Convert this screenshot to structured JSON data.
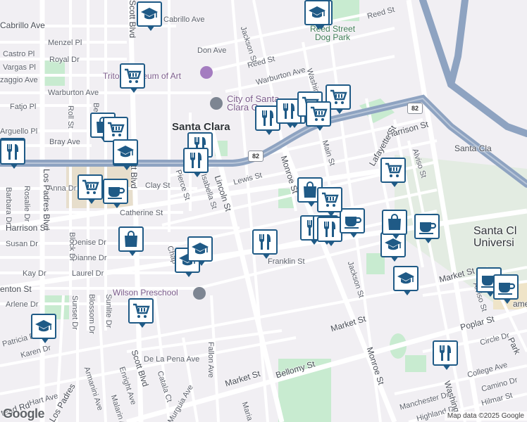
{
  "map": {
    "attribution": "Map data ©2025 Google",
    "logo": "Google",
    "colors": {
      "background": "#f1eff3",
      "road": "#ffffff",
      "highway": "#8ea3c1",
      "park": "#c8ebd0",
      "campus": "#e7decc",
      "marker_border": "#1f5a86",
      "marker_icon": "#1f5a86"
    }
  },
  "labels": {
    "cabrillo_ave_left": "Cabrillo Ave",
    "cabrillo_ave_top": "Cabrillo Ave",
    "menzel_pl": "Menzel Pl",
    "castro_pl": "Castro Pl",
    "royal_dr": "Royal Dr",
    "vargas_pl": "Vargas Pl",
    "zaggio_ave": "zaggio Ave",
    "warburton_ave_left": "Warburton Ave",
    "warburton_ave_right": "Warburton Ave",
    "fatjo_pl": "Fatjo Pl",
    "arguello_pl": "Arguello Pl",
    "bray_ave": "Bray Ave",
    "don_ave": "Don Ave",
    "reed_st_top": "Reed St",
    "reed_st_mid": "Reed St",
    "jackson_st_top": "Jackson St",
    "washington_top": "Washingt",
    "reed_street_dog_park": "Reed Street\nDog Park",
    "triton_museum": "Triton Museum of Art",
    "city_of_santa_clara": "City of Santa\nClara Gov...",
    "santa_clara": "Santa Clara",
    "santa_clara_right": "Santa Cla",
    "santa_clara_university": "Santa Cl\nUniversi",
    "harrison_st_right": "Harrison St",
    "harrison_st_left": "Harrison St",
    "lafayette_st": "Lafayette St",
    "main_st": "Main St",
    "monroe_st_mid": "Monroe St",
    "monroe_st_bottom": "Monroe St",
    "lincoln_st": "Lincoln St",
    "lewis_st": "Lewis St",
    "clay_st": "Clay St",
    "anna_dr": "Anna Dr",
    "pierce_st": "Pierce St",
    "isabella_st": "Isabella St",
    "catherine_st": "Catherine St",
    "susan_dr": "Susan Dr",
    "denise_dr": "Denise Dr",
    "dianne_dr": "Dianne Dr",
    "laurel_dr": "Laurel Dr",
    "kay_dr": "Kay Dr",
    "arlene_dr": "Arlene Dr",
    "benton_st": "enton St",
    "wilson_preschool": "Wilson Preschool",
    "franklin_st": "Franklin St",
    "jackson_st_lower": "Jackson St",
    "market_st_right": "Market St",
    "market_st_mid": "Market St",
    "market_st_left": "Market St",
    "alviso_st_upper": "Alviso St",
    "alviso_st_lower": "Alviso St",
    "poplar_st": "Poplar St",
    "circle_dr": "Circle Dr",
    "college_ave": "College Ave",
    "camino_dr": "Camino Dr",
    "hilmar_st": "Hilmar St",
    "manchester_dr": "Manchester Dr",
    "highland_dr": "Highland Dr",
    "washington_bottom": "Washing",
    "bellomy_st": "Bellomy St",
    "de_la_pena_ave": "De La Pena Ave",
    "fallon_ave": "Fallon Ave",
    "catala_ct": "Catala Ct",
    "murguia_ave": "Murguia Ave",
    "enright_ave": "Enright Ave",
    "malarin_ave": "Malarin A",
    "armanini_ave": "Armanini Ave",
    "hart_ave": "Hart Ave",
    "los_padres_blvd_top": "Los Padres Blvd",
    "los_padres_blvd_bottom": "Los Padres",
    "scott_blvd_top": "Scott Blvd",
    "scott_blvd_mid": "Scott Blvd",
    "scott_blvd_bottom": "Scott Blvd",
    "block_dr": "Block Dr",
    "rosalie_dr": "Rosalie Dr",
    "barbara_dr": "Barbara Dr",
    "roll_st": "Roll St",
    "bel_st": "Bel",
    "sunset_dr": "Sunset Dr",
    "blossom_dr": "Blossom Dr",
    "sunlite_dr": "Sunlite Dr",
    "karen_dr": "Karen Dr",
    "patricia_dr": "Patricia Dr",
    "mead_rd": "tead Rd",
    "chap": "Chap",
    "maria": "Maria",
    "park": "Park",
    "ame": "ame",
    "route_82": "82",
    "route_82_b": "82"
  },
  "markers": [
    {
      "name": "school-icon",
      "kind": "school"
    },
    {
      "name": "grocery-icon",
      "kind": "grocery"
    },
    {
      "name": "cafe-icon",
      "kind": "cafe"
    },
    {
      "name": "grocery-icon",
      "kind": "grocery"
    },
    {
      "name": "restaurant-icon",
      "kind": "restaurant"
    },
    {
      "name": "restaurant-icon",
      "kind": "restaurant"
    },
    {
      "name": "grocery-icon",
      "kind": "grocery"
    },
    {
      "name": "grocery-icon",
      "kind": "grocery"
    },
    {
      "name": "grocery-icon",
      "kind": "grocery"
    },
    {
      "name": "shopping-bag-icon",
      "kind": "shop"
    },
    {
      "name": "restaurant-icon",
      "kind": "restaurant"
    },
    {
      "name": "restaurant-icon",
      "kind": "restaurant"
    },
    {
      "name": "grocery-icon",
      "kind": "grocery"
    },
    {
      "name": "cafe-icon",
      "kind": "cafe"
    },
    {
      "name": "shopping-bag-icon",
      "kind": "shop"
    },
    {
      "name": "school-icon",
      "kind": "school"
    },
    {
      "name": "school-icon",
      "kind": "school"
    },
    {
      "name": "restaurant-icon",
      "kind": "restaurant"
    },
    {
      "name": "shopping-bag-icon",
      "kind": "shop"
    },
    {
      "name": "grocery-icon",
      "kind": "grocery"
    },
    {
      "name": "grocery-icon",
      "kind": "grocery"
    },
    {
      "name": "restaurant-icon",
      "kind": "restaurant"
    },
    {
      "name": "restaurant-icon",
      "kind": "restaurant"
    },
    {
      "name": "restaurant-icon",
      "kind": "restaurant"
    },
    {
      "name": "cafe-icon",
      "kind": "cafe"
    },
    {
      "name": "shopping-bag-icon",
      "kind": "shop"
    },
    {
      "name": "school-icon",
      "kind": "school"
    },
    {
      "name": "school-icon",
      "kind": "school"
    },
    {
      "name": "cafe-icon",
      "kind": "cafe"
    },
    {
      "name": "grocery-icon",
      "kind": "grocery"
    },
    {
      "name": "cafe-icon",
      "kind": "cafe"
    },
    {
      "name": "school-icon",
      "kind": "school"
    },
    {
      "name": "cafe-icon",
      "kind": "cafe"
    },
    {
      "name": "cafe-icon",
      "kind": "cafe"
    },
    {
      "name": "school-icon",
      "kind": "school"
    },
    {
      "name": "grocery-icon",
      "kind": "grocery"
    },
    {
      "name": "school-icon",
      "kind": "school"
    },
    {
      "name": "restaurant-icon",
      "kind": "restaurant"
    },
    {
      "name": "restaurant-icon",
      "kind": "restaurant"
    },
    {
      "name": "shopping-bag-icon",
      "kind": "shop"
    }
  ]
}
